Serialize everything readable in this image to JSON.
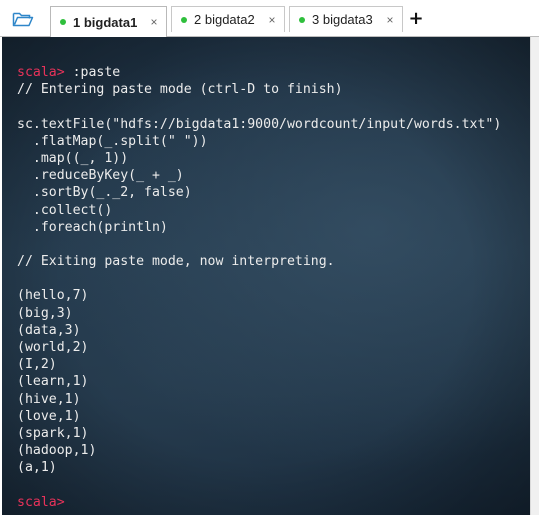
{
  "toolbar": {
    "folder_icon": "folder-open-icon"
  },
  "tabs": [
    {
      "label": "1 bigdata1",
      "active": true,
      "status_color": "#2fbf3c",
      "close": "×"
    },
    {
      "label": "2 bigdata2",
      "active": false,
      "status_color": "#2fbf3c",
      "close": "×"
    },
    {
      "label": "3 bigdata3",
      "active": false,
      "status_color": "#2fbf3c",
      "close": "×"
    }
  ],
  "add_tab": "+",
  "terminal": {
    "prompt_color": "#e8325a",
    "prompt": "scala>",
    "lines": [
      {
        "prompt": "scala>",
        "text": " :paste"
      },
      {
        "text": "// Entering paste mode (ctrl-D to finish)"
      },
      {
        "text": ""
      },
      {
        "text": "sc.textFile(\"hdfs://bigdata1:9000/wordcount/input/words.txt\")"
      },
      {
        "text": "  .flatMap(_.split(\" \"))"
      },
      {
        "text": "  .map((_, 1))"
      },
      {
        "text": "  .reduceByKey(_ + _)"
      },
      {
        "text": "  .sortBy(_._2, false)"
      },
      {
        "text": "  .collect()"
      },
      {
        "text": "  .foreach(println)"
      },
      {
        "text": ""
      },
      {
        "text": "// Exiting paste mode, now interpreting."
      },
      {
        "text": ""
      },
      {
        "text": "(hello,7)"
      },
      {
        "text": "(big,3)"
      },
      {
        "text": "(data,3)"
      },
      {
        "text": "(world,2)"
      },
      {
        "text": "(I,2)"
      },
      {
        "text": "(learn,1)"
      },
      {
        "text": "(hive,1)"
      },
      {
        "text": "(love,1)"
      },
      {
        "text": "(spark,1)"
      },
      {
        "text": "(hadoop,1)"
      },
      {
        "text": "(a,1)"
      },
      {
        "text": ""
      },
      {
        "prompt": "scala>",
        "text": ""
      }
    ]
  }
}
